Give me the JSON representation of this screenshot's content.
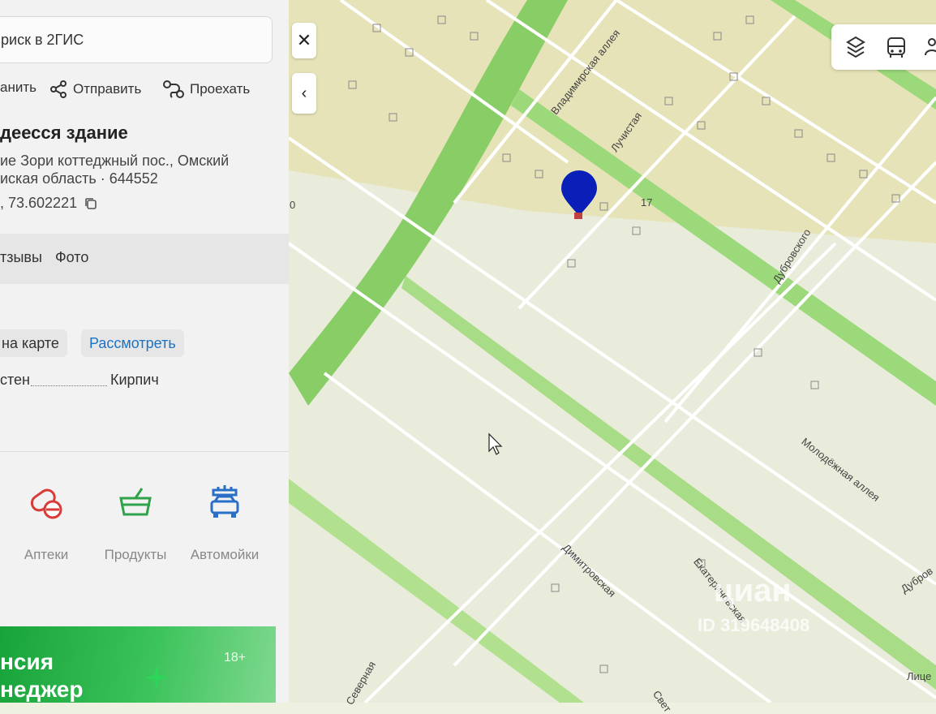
{
  "panel": {
    "search_text": "риск в 2ГИС",
    "close_icon": "close-icon",
    "collapse_icon": "chevron-left-icon",
    "actions": {
      "save": "анить",
      "share": "Отправить",
      "route": "Проехать"
    },
    "title": "деесся здание",
    "address_line1": "ие Зори коттеджный пос., Омский",
    "address_line2": "иская область · 644552",
    "coords": ", 73.602221",
    "tabs": {
      "reviews": "тзывы",
      "photo": "Фото"
    },
    "chips": {
      "on_map": "на карте",
      "view": "Рассмотреть"
    },
    "property": {
      "label": "стен",
      "value": "Кирпич"
    },
    "categories": [
      {
        "label": "Аптеки",
        "icon": "pharmacy-icon"
      },
      {
        "label": "Продукты",
        "icon": "basket-icon"
      },
      {
        "label": "Автомойки",
        "icon": "car-wash-icon"
      }
    ],
    "ad": {
      "line1": "нсия",
      "line2": "неджер",
      "age": "18+"
    }
  },
  "map": {
    "building_number": "17",
    "left_number": "0",
    "streets": {
      "vladimirskaya": "Владимирская аллея",
      "luchistaya": "Лучистая",
      "dubrovskogo": "Дубровского",
      "molodezhnaya": "Молодёжная аллея",
      "dimitrovskaya": "Димитровская",
      "ekaterinovskaya": "Екатериновская",
      "dubrovskogo2": "Дубров",
      "severnaya": "Северная",
      "svet": "Свет",
      "litse": "Лице"
    },
    "watermark": {
      "brand": "циан",
      "id": "ID 319648408"
    },
    "pin_color": "#0a1fb8",
    "green_color": "#8fd26a"
  },
  "colors": {
    "accent": "#1a73c8",
    "category_red": "#d93a3a",
    "category_green": "#2fa24a",
    "category_blue": "#2a6fc7"
  }
}
